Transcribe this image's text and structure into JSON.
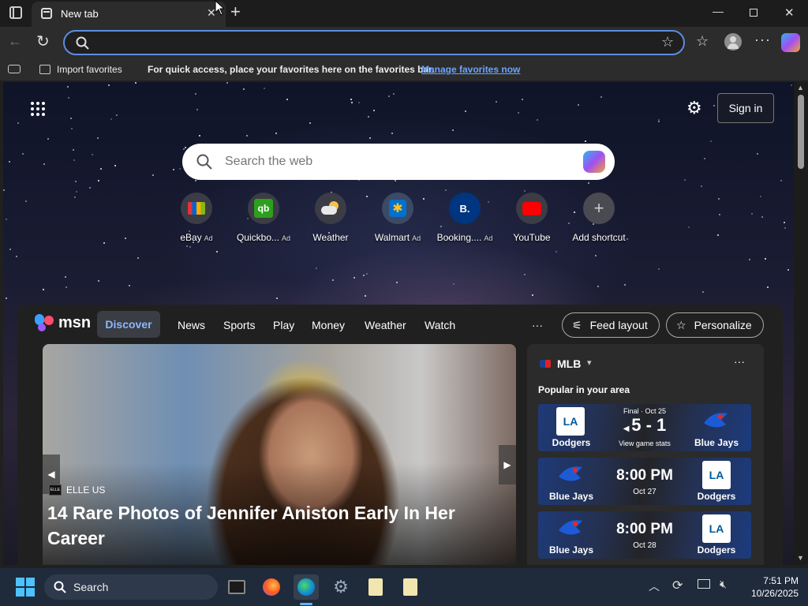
{
  "window": {
    "tab_title": "New tab",
    "add_tab_symbol": "+"
  },
  "toolbar": {
    "address_placeholder": ""
  },
  "favorites_bar": {
    "import_label": "Import favorites",
    "hint_text": "For quick access, place your favorites here on the favorites bar.",
    "manage_link": "Manage favorites now"
  },
  "newtab": {
    "sign_in_label": "Sign in",
    "search_placeholder": "Search the web",
    "shortcuts": [
      {
        "label": "eBay",
        "ad": "Ad",
        "icon": "ebay-icon"
      },
      {
        "label": "Quickbo...",
        "ad": "Ad",
        "icon": "quickbooks-icon"
      },
      {
        "label": "Weather",
        "ad": "",
        "icon": "weather-icon"
      },
      {
        "label": "Walmart",
        "ad": "Ad",
        "icon": "walmart-icon"
      },
      {
        "label": "Booking....",
        "ad": "Ad",
        "icon": "booking-icon"
      },
      {
        "label": "YouTube",
        "ad": "",
        "icon": "youtube-icon"
      },
      {
        "label": "Add shortcut",
        "ad": "",
        "icon": "plus-icon"
      }
    ]
  },
  "msn": {
    "logo_text": "msn",
    "nav": [
      "Discover",
      "News",
      "Sports",
      "Play",
      "Money",
      "Weather",
      "Watch"
    ],
    "more_symbol": "···",
    "feed_layout_label": "Feed layout",
    "personalize_label": "Personalize",
    "hero": {
      "source": "ELLE US",
      "source_logo_text": "ELLE",
      "headline": "14 Rare Photos of Jennifer Aniston Early In Her Career"
    },
    "mlb": {
      "title": "MLB",
      "subtitle": "Popular in your area",
      "more_symbol": "···",
      "games": [
        {
          "left_team": "Dodgers",
          "left_logo": "LA",
          "right_team": "Blue Jays",
          "status": "Final · Oct 25",
          "score": "5 - 1",
          "detail": "View game stats"
        },
        {
          "left_team": "Blue Jays",
          "right_team": "Dodgers",
          "right_logo": "LA",
          "time": "8:00 PM",
          "date": "Oct 27"
        },
        {
          "left_team": "Blue Jays",
          "right_team": "Dodgers",
          "right_logo": "LA",
          "time": "8:00 PM",
          "date": "Oct 28"
        }
      ]
    }
  },
  "taskbar": {
    "search_label": "Search",
    "time": "7:51 PM",
    "date": "10/26/2025"
  },
  "colors": {
    "accent": "#5b8de0",
    "link": "#6ba4ff",
    "taskbar": "#1f2a3a"
  }
}
